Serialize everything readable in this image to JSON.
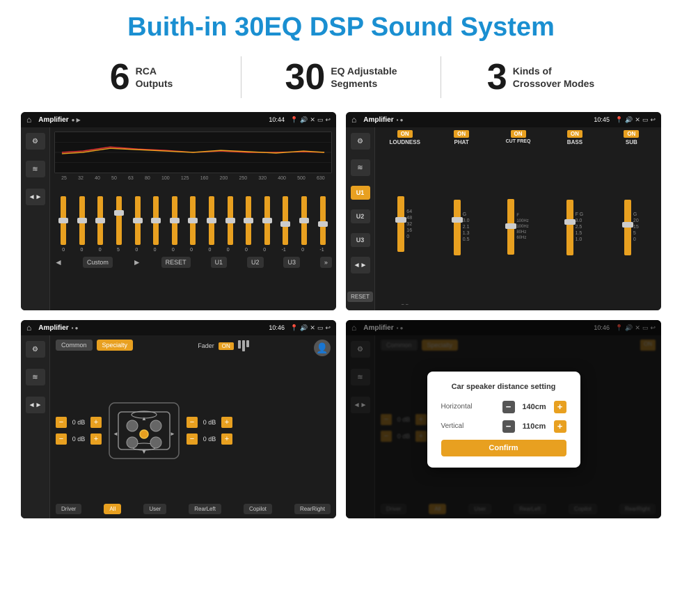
{
  "header": {
    "title": "Buith-in 30EQ DSP Sound System"
  },
  "stats": [
    {
      "number": "6",
      "label": "RCA\nOutputs"
    },
    {
      "number": "30",
      "label": "EQ Adjustable\nSegments"
    },
    {
      "number": "3",
      "label": "Kinds of\nCrossover Modes"
    }
  ],
  "screens": [
    {
      "id": "screen1",
      "status": {
        "app": "Amplifier",
        "time": "10:44"
      },
      "type": "eq",
      "freq_labels": [
        "25",
        "32",
        "40",
        "50",
        "63",
        "80",
        "100",
        "125",
        "160",
        "200",
        "250",
        "320",
        "400",
        "500",
        "630"
      ],
      "slider_values": [
        "0",
        "0",
        "0",
        "5",
        "0",
        "0",
        "0",
        "0",
        "0",
        "0",
        "0",
        "0",
        "-1",
        "0",
        "-1"
      ],
      "buttons": [
        "Custom",
        "RESET",
        "U1",
        "U2",
        "U3"
      ]
    },
    {
      "id": "screen2",
      "status": {
        "app": "Amplifier",
        "time": "10:45"
      },
      "type": "crossover",
      "u_buttons": [
        "U1",
        "U2",
        "U3"
      ],
      "columns": [
        {
          "on": true,
          "label": "LOUDNESS"
        },
        {
          "on": true,
          "label": "PHAT"
        },
        {
          "on": true,
          "label": "CUT FREQ"
        },
        {
          "on": true,
          "label": "BASS"
        },
        {
          "on": true,
          "label": "SUB"
        }
      ],
      "reset_label": "RESET"
    },
    {
      "id": "screen3",
      "status": {
        "app": "Amplifier",
        "time": "10:46"
      },
      "type": "speaker",
      "tabs": [
        "Common",
        "Specialty"
      ],
      "active_tab": "Specialty",
      "fader_label": "Fader",
      "fader_on": "ON",
      "db_values": [
        "0 dB",
        "0 dB",
        "0 dB",
        "0 dB"
      ],
      "bottom_btns": [
        "Driver",
        "All",
        "User",
        "RearLeft",
        "RearRight",
        "Copilot"
      ]
    },
    {
      "id": "screen4",
      "status": {
        "app": "Amplifier",
        "time": "10:46"
      },
      "type": "distance-dialog",
      "tabs": [
        "Common",
        "Specialty"
      ],
      "dialog": {
        "title": "Car speaker distance setting",
        "fields": [
          {
            "label": "Horizontal",
            "value": "140cm"
          },
          {
            "label": "Vertical",
            "value": "110cm"
          }
        ],
        "confirm_label": "Confirm"
      }
    }
  ]
}
